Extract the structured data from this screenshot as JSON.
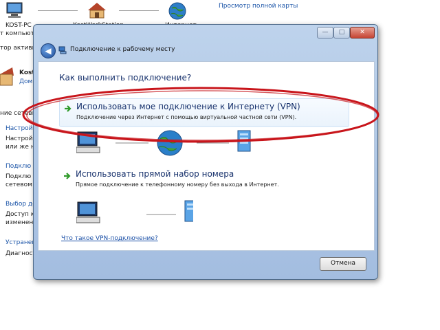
{
  "background": {
    "top_nodes": [
      {
        "label": "KOST-PC",
        "icon": "computer-icon"
      },
      {
        "label": "KostWorkStation",
        "icon": "house-icon"
      },
      {
        "label": "Интернет",
        "icon": "globe-icon"
      }
    ],
    "full_map_link": "Просмотр полной карты",
    "partial_texts": [
      "т компьют",
      "тор активны"
    ],
    "network_name": "Kost",
    "network_sub": "Дом",
    "change_settings": "ние сетевы",
    "left_items": [
      {
        "title": "Настрой",
        "lines": [
          "Настрой",
          "или же н"
        ]
      },
      {
        "title": "Подклю",
        "lines": [
          "Подклю",
          "сетевом"
        ]
      },
      {
        "title": "Выбор до",
        "lines": [
          "Доступ к",
          "изменен"
        ]
      },
      {
        "title": "Устранен",
        "lines": [
          "Диагност"
        ]
      }
    ]
  },
  "dialog": {
    "title": "Подключение к рабочему месту",
    "question": "Как выполнить подключение?",
    "options": [
      {
        "title": "Использовать мое подключение к Интернету (VPN)",
        "description": "Подключение через Интернет с помощью виртуальной частной сети (VPN)."
      },
      {
        "title": "Использовать прямой набор номера",
        "description": "Прямое подключение к телефонному номеру без выхода в Интернет."
      }
    ],
    "help_link": "Что такое VPN-подключение?",
    "cancel_label": "Отмена",
    "window_buttons": {
      "minimize": "—",
      "maximize": "□",
      "close": "✕"
    }
  },
  "colors": {
    "annotation": "#c8151b",
    "link": "#1a4fa6",
    "heading": "#16306b"
  }
}
